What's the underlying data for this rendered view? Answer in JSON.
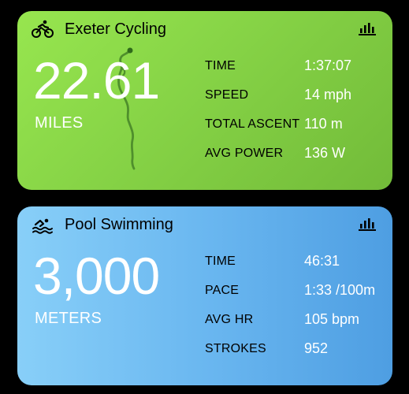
{
  "cards": [
    {
      "title": "Exeter Cycling",
      "activity_icon": "cycling-icon",
      "value": "22.61",
      "unit": "MILES",
      "stats": [
        {
          "label": "TIME",
          "value": "1:37:07"
        },
        {
          "label": "SPEED",
          "value": "14 mph"
        },
        {
          "label": "TOTAL ASCENT",
          "value": "110 m"
        },
        {
          "label": "AVG POWER",
          "value": "136 W"
        }
      ]
    },
    {
      "title": "Pool Swimming",
      "activity_icon": "swimming-icon",
      "value": "3,000",
      "unit": "METERS",
      "stats": [
        {
          "label": "TIME",
          "value": "46:31"
        },
        {
          "label": "PACE",
          "value": "1:33 /100m"
        },
        {
          "label": "AVG HR",
          "value": "105 bpm"
        },
        {
          "label": "STROKES",
          "value": "952"
        }
      ]
    }
  ],
  "colors": {
    "cycling_card": "#86d346",
    "swimming_card": "#6ab7f0",
    "route_line": "#4f8f2c",
    "label_text": "#000000",
    "value_text": "#ffffff"
  }
}
